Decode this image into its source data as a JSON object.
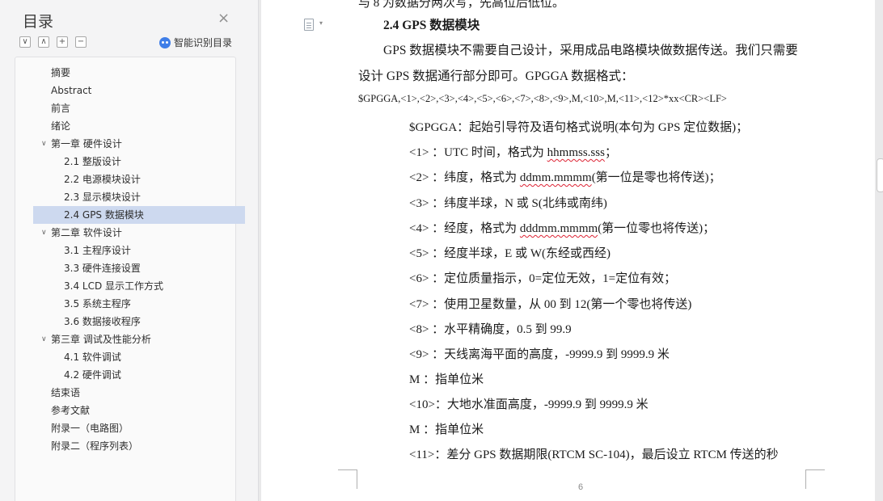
{
  "nav": {
    "title": "目录",
    "close_glyph": "×",
    "tools": [
      "∨",
      "∧",
      "+",
      "−"
    ],
    "smart_label": "智能识别目录",
    "toc": [
      {
        "label": "摘要",
        "level": 1
      },
      {
        "label": "Abstract",
        "level": 1
      },
      {
        "label": "前言",
        "level": 1
      },
      {
        "label": "绪论",
        "level": 1
      },
      {
        "label": "第一章  硬件设计",
        "level": "ch"
      },
      {
        "label": "2.1  整版设计",
        "level": 2
      },
      {
        "label": "2.2  电源模块设计",
        "level": 2
      },
      {
        "label": "2.3  显示模块设计",
        "level": 2
      },
      {
        "label": "2.4 GPS 数据模块",
        "level": 2,
        "active": true
      },
      {
        "label": "第二章  软件设计",
        "level": "ch"
      },
      {
        "label": "3.1  主程序设计",
        "level": 2
      },
      {
        "label": "3.3  硬件连接设置",
        "level": 2
      },
      {
        "label": "3.4 LCD 显示工作方式",
        "level": 2
      },
      {
        "label": "3.5  系统主程序",
        "level": 2
      },
      {
        "label": "3.6  数据接收程序",
        "level": 2
      },
      {
        "label": "第三章    调试及性能分析",
        "level": "ch"
      },
      {
        "label": "4.1 软件调试",
        "level": 2
      },
      {
        "label": "4.2 硬件调试",
        "level": 2
      },
      {
        "label": "结束语",
        "level": 1
      },
      {
        "label": "参考文献",
        "level": 1
      },
      {
        "label": "附录一（电路图）",
        "level": 1
      },
      {
        "label": "附录二（程序列表）",
        "level": 1
      }
    ]
  },
  "doc": {
    "cut_line": "与 8 为数据分两次写，先高位后低位。",
    "heading": "2.4 GPS 数据模块",
    "para1_a": "GPS 数据模块不需要自己设计，采用成品电路模块做数据传送。我们只需要",
    "para1_b": "设计 GPS 数据通行部分即可。GPGGA 数据格式：",
    "format": "$GPGGA,<1>,<2>,<3>,<4>,<5>,<6>,<7>,<8>,<9>,M,<10>,M,<11>,<12>*xx<CR><LF>",
    "items": [
      {
        "a": "$GPGGA：起始引导符及语句格式说明(本句为 GPS 定位数据)；"
      },
      {
        "a": "<1> ：UTC 时间，格式为 ",
        "u": "hhmmss.sss",
        "b": "；"
      },
      {
        "a": "<2> ：纬度，格式为 ",
        "u": "ddmm.mmmm",
        "b": "(第一位是零也将传送)；"
      },
      {
        "a": "<3> ：纬度半球，N 或 S(北纬或南纬)"
      },
      {
        "a": "<4> ：经度，格式为 ",
        "u": "dddmm.mmmm",
        "b": "(第一位零也将传送)；"
      },
      {
        "a": "<5> ：经度半球，E 或 W(东经或西经)"
      },
      {
        "a": "<6> ：定位质量指示，0=定位无效，1=定位有效；"
      },
      {
        "a": "<7> ：使用卫星数量，从 00 到 12(第一个零也将传送)"
      },
      {
        "a": "<8> ：水平精确度，0.5 到 99.9"
      },
      {
        "a": "<9> ：天线离海平面的高度，-9999.9 到 9999.9 米"
      },
      {
        "a": "  M   ：指单位米"
      },
      {
        "a": "<10>：大地水准面高度，-9999.9 到 9999.9 米"
      },
      {
        "a": "  M   ：指单位米"
      },
      {
        "a": "<11>：差分 GPS 数据期限(RTCM SC-104)，最后设立 RTCM 传送的秒"
      }
    ],
    "page_number": "6"
  }
}
